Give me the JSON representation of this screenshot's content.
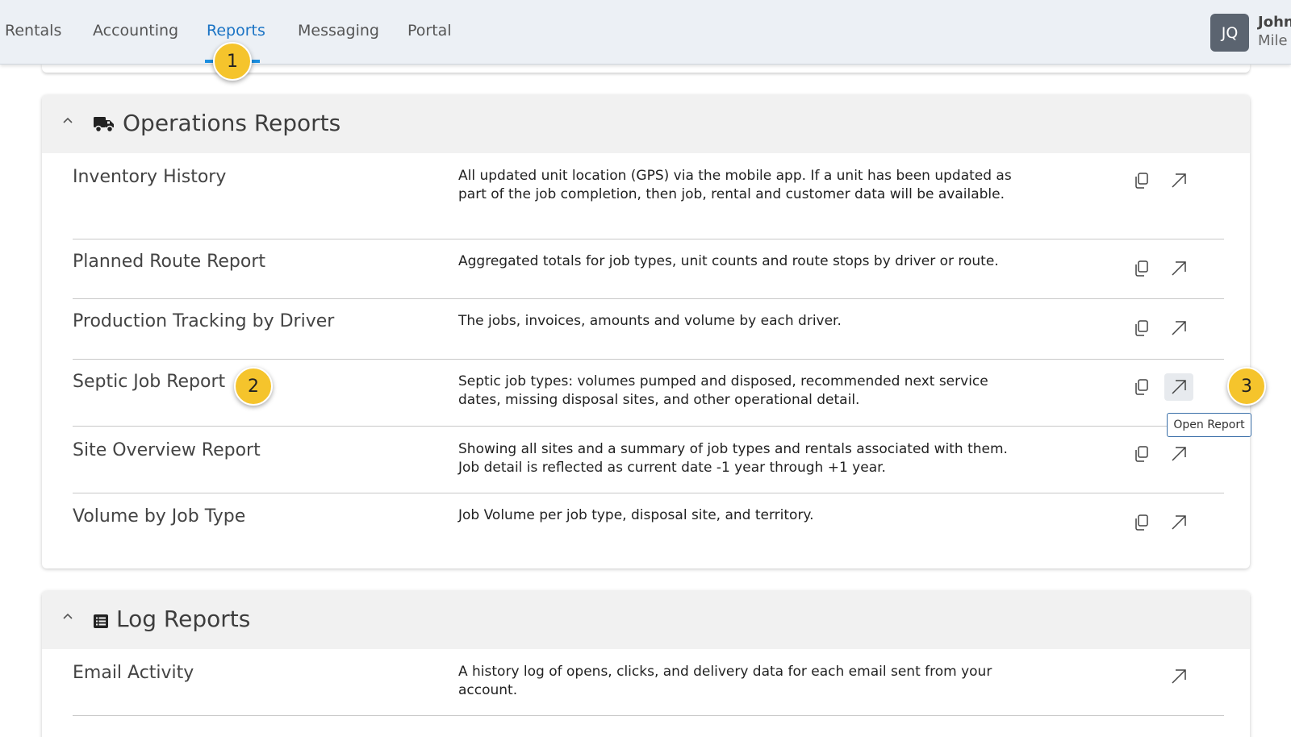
{
  "nav": {
    "items": [
      "Rentals",
      "Accounting",
      "Reports",
      "Messaging",
      "Portal"
    ],
    "active": "Reports"
  },
  "user": {
    "initials": "JQ",
    "first_name": "John",
    "last_name": "Mile"
  },
  "steps": [
    "1",
    "2",
    "3"
  ],
  "tooltip": "Open Report",
  "operations": {
    "title": "Operations Reports",
    "reports": [
      {
        "name": "Inventory History",
        "description": "All updated unit location (GPS) via the mobile app. If a unit has been updated as part of the job completion, then job, rental and customer data will be available."
      },
      {
        "name": "Planned Route Report",
        "description": "Aggregated totals for job types, unit counts and route stops by driver or route."
      },
      {
        "name": "Production Tracking by Driver",
        "description": "The jobs, invoices, amounts and volume by each driver."
      },
      {
        "name": "Septic Job Report",
        "description": "Septic job types: volumes pumped and disposed, recommended next service dates, missing disposal sites, and other operational detail."
      },
      {
        "name": "Site Overview Report",
        "description": "Showing all sites and a summary of job types and rentals associated with them. Job detail is reflected as current date -1 year through +1 year."
      },
      {
        "name": "Volume by Job Type",
        "description": "Job Volume per job type, disposal site, and territory."
      }
    ]
  },
  "logs": {
    "title": "Log Reports",
    "reports": [
      {
        "name": "Email Activity",
        "description": "A history log of opens, clicks, and delivery data for each email sent from your account."
      }
    ]
  },
  "colors": {
    "accent": "#1b8ee0",
    "step_marker": "#f5c42c",
    "avatar": "#5b6470"
  }
}
